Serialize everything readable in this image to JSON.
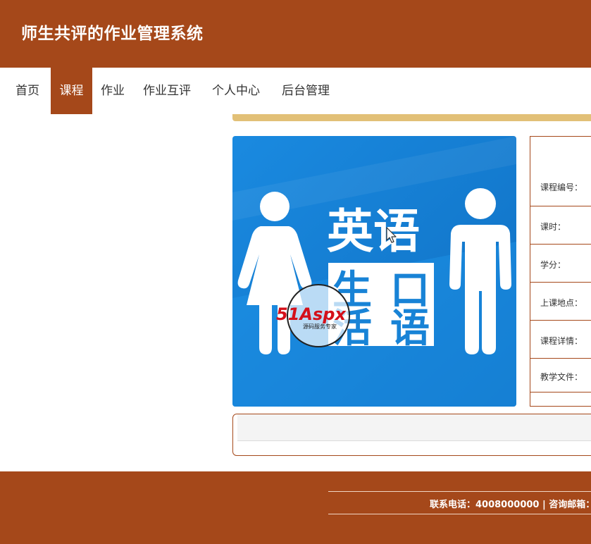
{
  "header": {
    "title": "师生共评的作业管理系统"
  },
  "nav": {
    "items": [
      {
        "label": "首页",
        "active": false
      },
      {
        "label": "课程",
        "active": true
      },
      {
        "label": "作业",
        "active": false
      },
      {
        "label": "作业互评",
        "active": false
      },
      {
        "label": "个人中心",
        "active": false
      },
      {
        "label": "后台管理",
        "active": false
      }
    ]
  },
  "course": {
    "image_text": {
      "line1": "英语",
      "line2a": "生",
      "line2b": "口",
      "line3a": "活",
      "line3b": "语"
    },
    "fields": [
      {
        "label": "课程编号："
      },
      {
        "label": "课时："
      },
      {
        "label": "学分："
      },
      {
        "label": "上课地点："
      },
      {
        "label": "课程详情："
      },
      {
        "label": "教学文件："
      }
    ]
  },
  "watermark": {
    "brand": "51Aspx",
    "tagline": "源码服务专家"
  },
  "footer": {
    "contact": "联系电话：4008000000 | 咨询邮箱："
  },
  "colors": {
    "brand": "#a5481a",
    "accent": "#e2c077",
    "image_blue": "#1883d6"
  }
}
